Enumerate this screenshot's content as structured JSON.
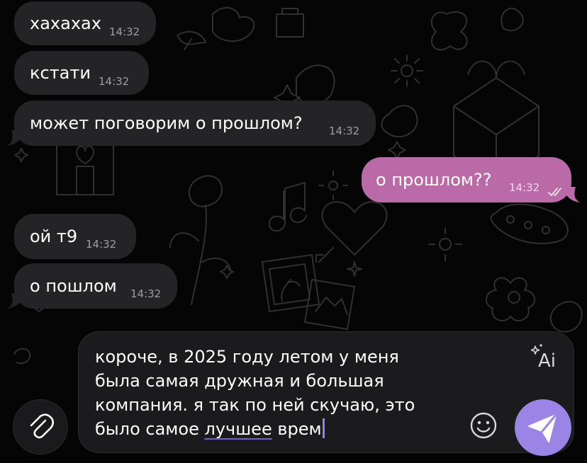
{
  "theme": {
    "background": "#050506",
    "incoming_bubble": "#242427",
    "outgoing_bubble": "#b96aa7",
    "send_button": "#9a84e6",
    "caret": "#8c82ff"
  },
  "messages": [
    {
      "direction": "incoming",
      "text": "хахахах",
      "time": "14:32"
    },
    {
      "direction": "incoming",
      "text": "кстати",
      "time": "14:32"
    },
    {
      "direction": "incoming",
      "text": "может поговорим о прошлом?",
      "time": "14:32"
    },
    {
      "direction": "outgoing",
      "text": "о прошлом??",
      "time": "14:32",
      "status_icon": "double-check-icon"
    },
    {
      "direction": "incoming",
      "text": "ой т9",
      "time": "14:32"
    },
    {
      "direction": "incoming",
      "text": "о пошлом",
      "time": "14:32"
    }
  ],
  "composer": {
    "lines": [
      "короче, в 2025 году летом у меня",
      "была самая дружная и большая",
      "компания. я так по ней скучаю, это"
    ],
    "last_line_before_underline": "было самое ",
    "last_line_underlined": "лучшее",
    "last_line_after_underline": " врем",
    "ai_label": "Ai",
    "ai_icon": "sparkle-ai-icon",
    "emoji_icon": "emoji-icon",
    "attach_icon": "paperclip-icon",
    "send_icon": "send-arrow-icon"
  }
}
